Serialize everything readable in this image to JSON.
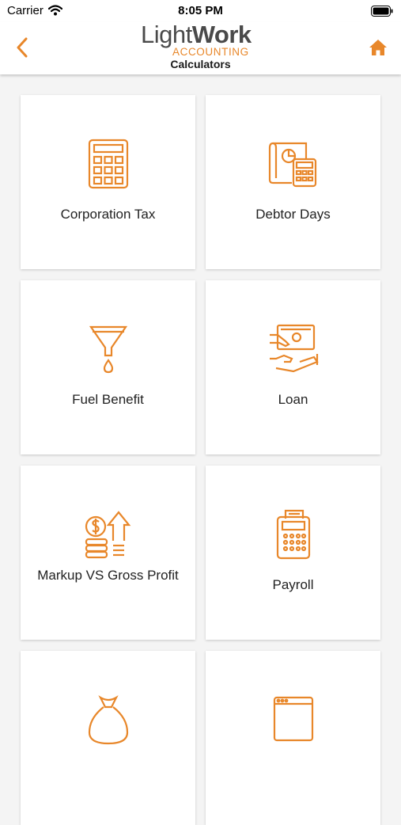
{
  "status_bar": {
    "carrier": "Carrier",
    "time": "8:05 PM"
  },
  "header": {
    "logo_light": "Light",
    "logo_work": "Work",
    "logo_accounting": "ACCOUNTING",
    "title": "Calculators",
    "back_icon": "chevron-left-icon",
    "home_icon": "home-icon"
  },
  "colors": {
    "accent": "#e8872a",
    "background": "#f4f4f4",
    "card": "#ffffff",
    "text": "#222222"
  },
  "calculators": [
    {
      "label": "Corporation Tax",
      "icon": "calculator-icon"
    },
    {
      "label": "Debtor Days",
      "icon": "invoice-calculator-icon"
    },
    {
      "label": "Fuel Benefit",
      "icon": "funnel-icon"
    },
    {
      "label": "Loan",
      "icon": "cash-hand-icon"
    },
    {
      "label": "Markup VS Gross Profit",
      "icon": "coins-arrow-icon"
    },
    {
      "label": "Payroll",
      "icon": "card-terminal-icon"
    },
    {
      "label": "",
      "icon": "money-bag-icon"
    },
    {
      "label": "",
      "icon": "browser-window-icon"
    }
  ]
}
